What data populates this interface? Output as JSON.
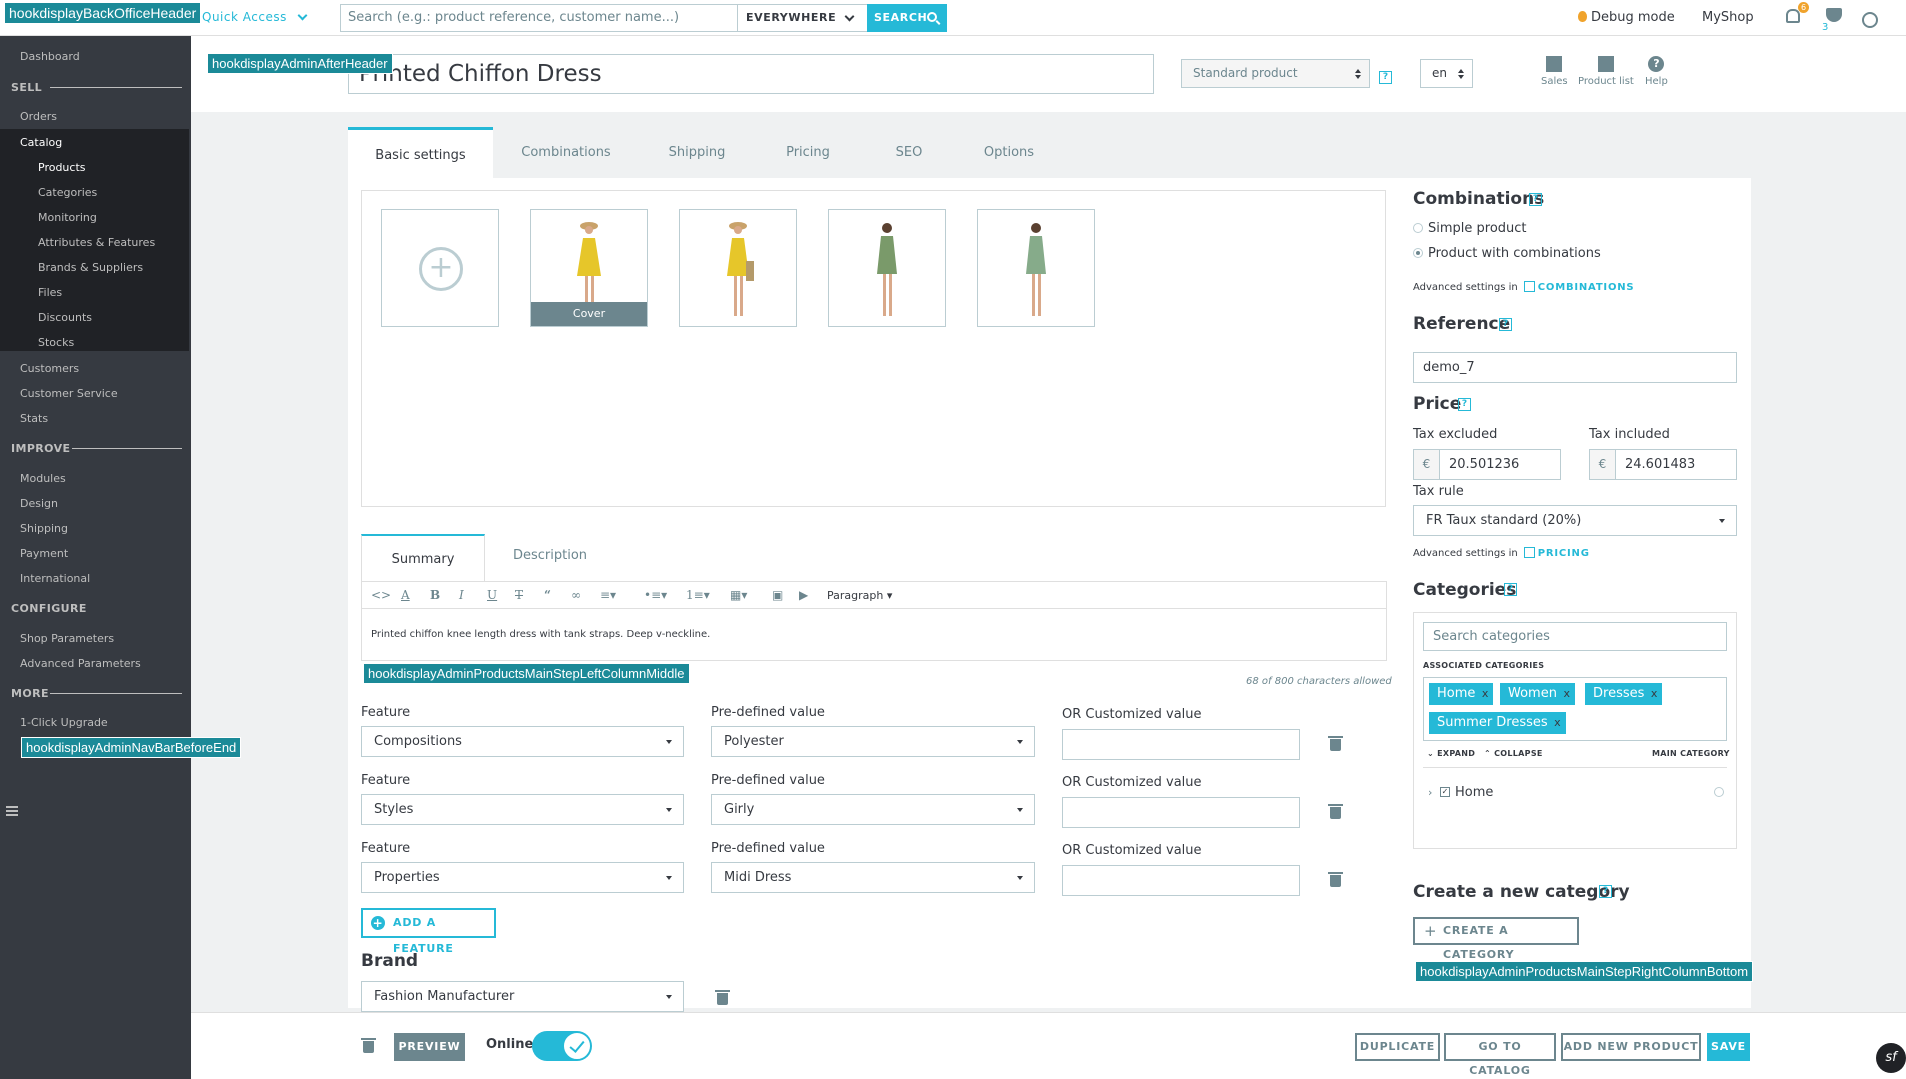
{
  "hooks": {
    "back_office_header": "hookdisplayBackOfficeHeader",
    "admin_after_header": "hookdisplayAdminAfterHeader",
    "left_column_middle": "hookdisplayAdminProductsMainStepLeftColumnMiddle",
    "nav_bar_before_end": "hookdisplayAdminNavBarBeforeEnd",
    "right_column_bottom": "hookdisplayAdminProductsMainStepRightColumnBottom"
  },
  "header": {
    "quick_access": "Quick Access",
    "search_placeholder": "Search (e.g.: product reference, customer name...)",
    "search_scope": "EVERYWHERE",
    "search_button": "SEARCH",
    "debug_mode": "Debug mode",
    "shop_name": "MyShop",
    "notif_count": "6",
    "trophy_count": "3"
  },
  "sidebar": {
    "dashboard": "Dashboard",
    "sell": "SELL",
    "orders": "Orders",
    "catalog": "Catalog",
    "catalog_sub": [
      "Products",
      "Categories",
      "Monitoring",
      "Attributes & Features",
      "Brands & Suppliers",
      "Files",
      "Discounts",
      "Stocks"
    ],
    "customers": "Customers",
    "customer_service": "Customer Service",
    "stats": "Stats",
    "improve": "IMPROVE",
    "modules": "Modules",
    "design": "Design",
    "shipping": "Shipping",
    "payment": "Payment",
    "international": "International",
    "configure": "CONFIGURE",
    "shop_parameters": "Shop Parameters",
    "advanced_parameters": "Advanced Parameters",
    "more": "MORE",
    "one_click_upgrade": "1-Click Upgrade"
  },
  "product": {
    "name": "Printed Chiffon Dress",
    "type": "Standard product",
    "lang": "en",
    "actions": {
      "sales": "Sales",
      "product_list": "Product list",
      "help": "Help"
    }
  },
  "tabs": [
    "Basic settings",
    "Combinations",
    "Shipping",
    "Pricing",
    "SEO",
    "Options"
  ],
  "images": {
    "cover_label": "Cover"
  },
  "summary": {
    "tab_summary": "Summary",
    "tab_description": "Description",
    "paragraph": "Paragraph",
    "text": "Printed chiffon knee length dress with tank straps. Deep v-neckline.",
    "char_count": "68 of 800 characters allowed"
  },
  "features": {
    "feature_label": "Feature",
    "predefined_label": "Pre-defined value",
    "custom_label": "OR Customized value",
    "rows": [
      {
        "feature": "Compositions",
        "value": "Polyester"
      },
      {
        "feature": "Styles",
        "value": "Girly"
      },
      {
        "feature": "Properties",
        "value": "Midi Dress"
      }
    ],
    "add_feature": "ADD A FEATURE"
  },
  "brand": {
    "title": "Brand",
    "value": "Fashion Manufacturer"
  },
  "right": {
    "combinations_title": "Combinations",
    "simple_product": "Simple product",
    "product_with_combinations": "Product with combinations",
    "advanced_settings_in": "Advanced settings in",
    "combinations_link": "COMBINATIONS",
    "reference_title": "Reference",
    "reference_value": "demo_7",
    "price_title": "Price",
    "tax_excluded": "Tax excluded",
    "tax_included": "Tax included",
    "currency": "€",
    "price_excl": "20.501236",
    "price_incl": "24.601483",
    "tax_rule_label": "Tax rule",
    "tax_rule_value": "FR Taux standard (20%)",
    "pricing_link": "PRICING",
    "categories_title": "Categories",
    "search_categories": "Search categories",
    "associated_categories": "ASSOCIATED CATEGORIES",
    "tags": [
      "Home",
      "Women",
      "Dresses",
      "Summer Dresses"
    ],
    "expand": "EXPAND",
    "collapse": "COLLAPSE",
    "main_category": "MAIN CATEGORY",
    "tree_home": "Home",
    "new_category_title": "Create a new category",
    "create_category": "CREATE A CATEGORY"
  },
  "footer": {
    "preview": "PREVIEW",
    "online": "Online",
    "duplicate": "DUPLICATE",
    "go_to_catalog": "GO TO CATALOG",
    "add_new_product": "ADD NEW PRODUCT",
    "save": "SAVE"
  },
  "colors": {
    "accent": "#25b9d7",
    "sidebar": "#363a41",
    "hook": "#1b8a98"
  }
}
